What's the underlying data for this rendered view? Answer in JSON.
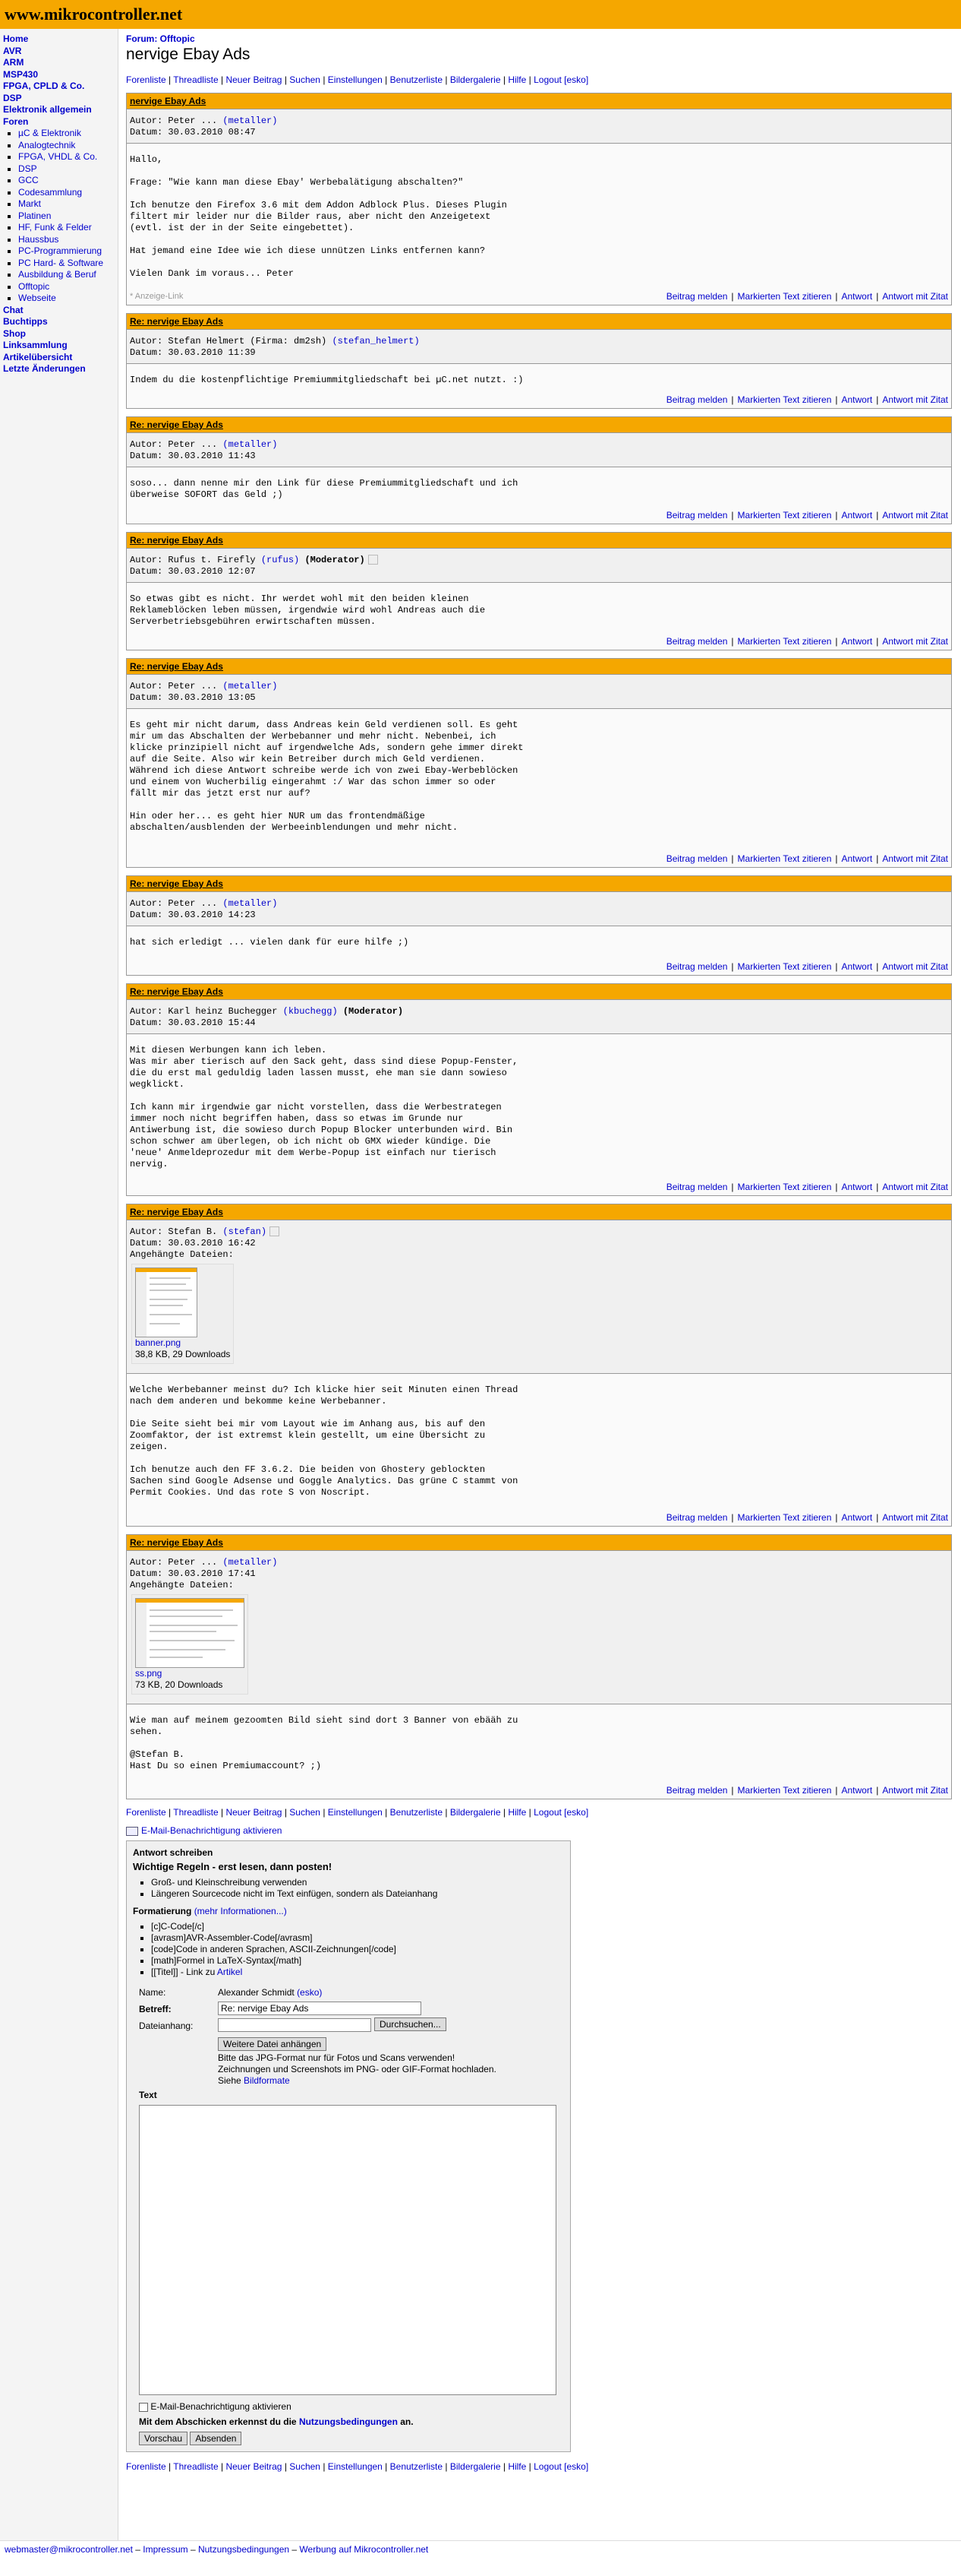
{
  "site": {
    "logo": "www.mikrocontroller.net"
  },
  "sidebar": {
    "top": [
      "Home",
      "AVR",
      "ARM",
      "MSP430",
      "FPGA, CPLD & Co.",
      "DSP",
      "Elektronik allgemein",
      "Foren"
    ],
    "forums": [
      "µC & Elektronik",
      "Analogtechnik",
      "FPGA, VHDL & Co.",
      "DSP",
      "GCC",
      "Codesammlung",
      "Markt",
      "Platinen",
      "HF, Funk & Felder",
      "Haussbus",
      "PC-Programmierung",
      "PC Hard- & Software",
      "Ausbildung & Beruf",
      "Offtopic",
      "Webseite"
    ],
    "bottom": [
      "Chat",
      "Buchtipps",
      "Shop",
      "Linksammlung",
      "Artikelübersicht",
      "Letzte Änderungen"
    ]
  },
  "page": {
    "forum_label": "Forum: Offtopic",
    "title": "nervige Ebay Ads"
  },
  "menu": [
    "Forenliste",
    "Threadliste",
    "Neuer Beitrag",
    "Suchen",
    "Einstellungen",
    "Benutzerliste",
    "Bildergalerie",
    "Hilfe",
    "Logout [esko]"
  ],
  "actions": [
    "Beitrag melden",
    "Markierten Text zitieren",
    "Antwort",
    "Antwort mit Zitat"
  ],
  "posts": [
    {
      "subject": "nervige Ebay Ads",
      "author": "Autor: Peter ... ",
      "user": "(metaller)",
      "date": "Datum: 30.03.2010 08:47",
      "body": "Hallo,\n\nFrage: \"Wie kann man diese Ebay' Werbebalätigung abschalten?\"\n\nIch benutze den Firefox 3.6 mit dem Addon Adblock Plus. Dieses Plugin\nfiltert mir leider nur die Bilder raus, aber nicht den Anzeigetext\n(evtl. ist der in der Seite eingebettet).\n\nHat jemand eine Idee wie ich diese unnützen Links entfernen kann?\n\nVielen Dank im voraus... Peter",
      "ad": "* Anzeige-Link"
    },
    {
      "subject": "Re: nervige Ebay Ads",
      "author": "Autor: Stefan Helmert (Firma: dm2sh) ",
      "user": "(stefan_helmert)",
      "date": "Datum: 30.03.2010 11:39",
      "body": "Indem du die kostenpflichtige Premiummitgliedschaft bei µC.net nutzt. :)"
    },
    {
      "subject": "Re: nervige Ebay Ads",
      "author": "Autor: Peter ... ",
      "user": "(metaller)",
      "date": "Datum: 30.03.2010 11:43",
      "body": "soso... dann nenne mir den Link für diese Premiummitgliedschaft und ich\nüberweise SOFORT das Geld ;)"
    },
    {
      "subject": "Re: nervige Ebay Ads",
      "author": "Autor: Rufus t. Firefly ",
      "user": "(rufus)",
      "mod": "(Moderator)",
      "date": "Datum: 30.03.2010 12:07",
      "body": "So etwas gibt es nicht. Ihr werdet wohl mit den beiden kleinen\nReklameblöcken leben müssen, irgendwie wird wohl Andreas auch die\nServerbetriebsgebühren erwirtschaften müssen."
    },
    {
      "subject": "Re: nervige Ebay Ads",
      "author": "Autor: Peter ... ",
      "user": "(metaller)",
      "date": "Datum: 30.03.2010 13:05",
      "body": "Es geht mir nicht darum, dass Andreas kein Geld verdienen soll. Es geht\nmir um das Abschalten der Werbebanner und mehr nicht. Nebenbei, ich\nklicke prinzipiell nicht auf irgendwelche Ads, sondern gehe immer direkt\nauf die Seite. Also wir kein Betreiber durch mich Geld verdienen.\nWährend ich diese Antwort schreibe werde ich von zwei Ebay-Werbeblöcken\nund einem von Wucherbilig eingerahmt :/ War das schon immer so oder\nfällt mir das jetzt erst nur auf?\n\nHin oder her... es geht hier NUR um das frontendmäßige\nabschalten/ausblenden der Werbeeinblendungen und mehr nicht."
    },
    {
      "subject": "Re: nervige Ebay Ads",
      "author": "Autor: Peter ... ",
      "user": "(metaller)",
      "date": "Datum: 30.03.2010 14:23",
      "body": "hat sich erledigt ... vielen dank für eure hilfe ;)"
    },
    {
      "subject": "Re: nervige Ebay Ads",
      "author": "Autor: Karl heinz Buchegger ",
      "user": "(kbuchegg)",
      "mod": "(Moderator)",
      "date": "Datum: 30.03.2010 15:44",
      "body": "Mit diesen Werbungen kann ich leben.\nWas mir aber tierisch auf den Sack geht, dass sind diese Popup-Fenster,\ndie du erst mal geduldig laden lassen musst, ehe man sie dann sowieso\nwegklickt.\n\nIch kann mir irgendwie gar nicht vorstellen, dass die Werbestrategen\nimmer noch nicht begriffen haben, dass so etwas im Grunde nur\nAntiwerbung ist, die sowieso durch Popup Blocker unterbunden wird. Bin\nschon schwer am überlegen, ob ich nicht ob GMX wieder kündige. Die\n'neue' Anmeldeprozedur mit dem Werbe-Popup ist einfach nur tierisch\nnervig."
    },
    {
      "subject": "Re: nervige Ebay Ads",
      "author": "Autor: Stefan B. ",
      "user": "(stefan)",
      "date": "Datum: 30.03.2010 16:42",
      "attach_label": "Angehängte Dateien:",
      "file": "banner.png",
      "fileinfo": "38,8 KB, 29 Downloads",
      "body": "Welche Werbebanner meinst du? Ich klicke hier seit Minuten einen Thread\nnach dem anderen und bekomme keine Werbebanner.\n\nDie Seite sieht bei mir vom Layout wie im Anhang aus, bis auf den\nZoomfaktor, der ist extremst klein gestellt, um eine Übersicht zu\nzeigen.\n\nIch benutze auch den FF 3.6.2. Die beiden von Ghostery geblockten\nSachen sind Google Adsense und Goggle Analytics. Das grüne C stammt von\nPermit Cookies. Und das rote S von Noscript."
    },
    {
      "subject": "Re: nervige Ebay Ads",
      "author": "Autor: Peter ... ",
      "user": "(metaller)",
      "date": "Datum: 30.03.2010 17:41",
      "attach_label": "Angehängte Dateien:",
      "file": "ss.png",
      "fileinfo": "73 KB, 20 Downloads",
      "body": "Wie man auf meinem gezoomten Bild sieht sind dort 3 Banner von ebääh zu\nsehen.\n\n@Stefan B.\nHast Du so einen Premiumaccount? ;)"
    }
  ],
  "mail_notify": "E-Mail-Benachrichtigung aktivieren",
  "reply": {
    "header": "Antwort schreiben",
    "rules_title": "Wichtige Regeln - erst lesen, dann posten!",
    "rules": [
      "Groß- und Kleinschreibung verwenden",
      "Längeren Sourcecode nicht im Text einfügen, sondern als Dateianhang"
    ],
    "format_title": "Formatierung",
    "format_more": "(mehr Informationen...)",
    "format_items": [
      "[c]C-Code[/c]",
      "[avrasm]AVR-Assembler-Code[/avrasm]",
      "[code]Code in anderen Sprachen, ASCII-Zeichnungen[/code]",
      "[math]Formel in LaTeX-Syntax[/math]",
      "[[Titel]] - Link zu "
    ],
    "format_link": "Artikel",
    "name_label": "Name:",
    "name_value": "Alexander Schmidt",
    "name_user": "(esko)",
    "subject_label": "Betreff:",
    "subject_value": "Re: nervige Ebay Ads",
    "file_label": "Dateianhang:",
    "browse": "Durchsuchen...",
    "more_files": "Weitere Datei anhängen",
    "hint1": "Bitte das JPG-Format nur für Fotos und Scans verwenden!",
    "hint2": "Zeichnungen und Screenshots im PNG- oder GIF-Format hochladen.",
    "hint3": "Siehe ",
    "hint3_link": "Bildformate",
    "text_label": "Text",
    "notify": "E-Mail-Benachrichtigung aktivieren",
    "terms_pre": "Mit dem Abschicken erkennst du die ",
    "terms_link": "Nutzungsbedingungen",
    "terms_post": " an.",
    "preview": "Vorschau",
    "submit": "Absenden"
  },
  "footer": {
    "links": [
      "webmaster@mikrocontroller.net",
      "Impressum",
      "Nutzungsbedingungen",
      "Werbung auf Mikrocontroller.net"
    ]
  }
}
